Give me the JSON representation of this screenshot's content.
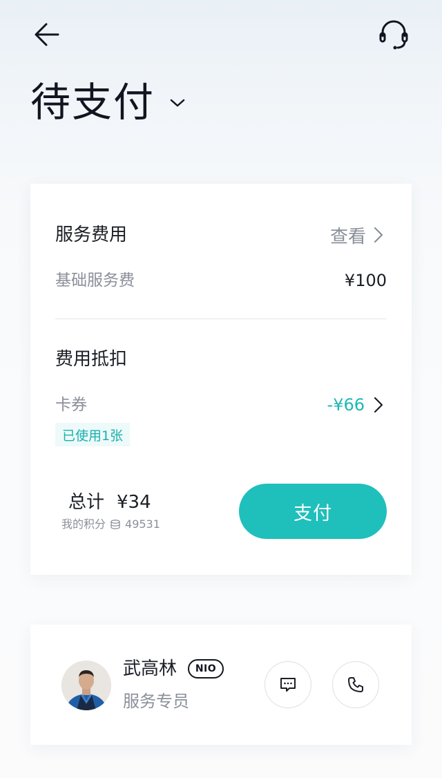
{
  "header": {
    "back_icon": "arrow-left-icon",
    "support_icon": "headset-icon",
    "title": "待支付",
    "title_dropdown_icon": "chevron-down-icon"
  },
  "fee_card": {
    "service_fee_title": "服务费用",
    "view_label": "查看",
    "base_fee_label": "基础服务费",
    "base_fee_amount": "¥100",
    "deduction_title": "费用抵扣",
    "coupon_label": "卡券",
    "coupon_amount": "-¥66",
    "coupon_used": "已使用1张",
    "total_label": "总计",
    "total_amount": "¥34",
    "points_label": "我的积分",
    "points_value": "49531",
    "pay_label": "支付",
    "accent_color": "#1fbfbc"
  },
  "agent": {
    "name": "武高林",
    "brand": "NIO",
    "role": "服务专员",
    "message_icon": "chat-bubble-icon",
    "call_icon": "phone-icon"
  }
}
